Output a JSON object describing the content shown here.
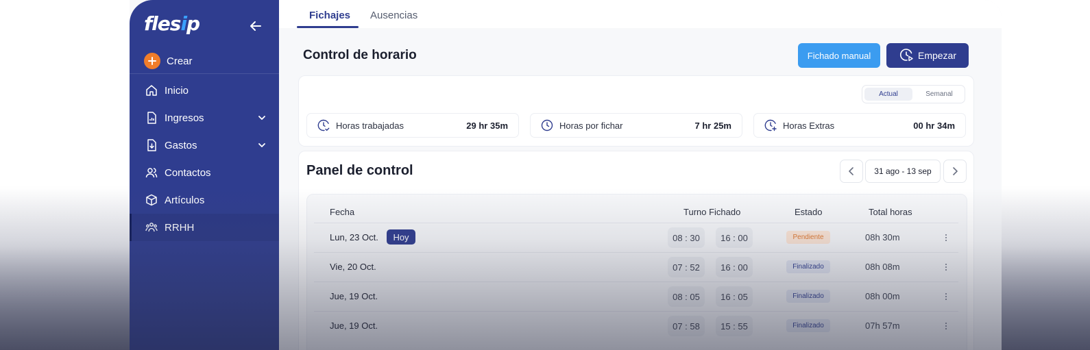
{
  "colors": {
    "brand": "#2f3d8f",
    "accent_blue": "#3b9cf0",
    "create_orange": "#f07d2a",
    "pending": "#e07a33"
  },
  "sidebar": {
    "logo": "flesip",
    "back_icon": "arrow-left-icon",
    "create_label": "Crear",
    "items": [
      {
        "label": "Inicio",
        "icon": "home-icon"
      },
      {
        "label": "Ingresos",
        "icon": "invoice-icon",
        "expandable": true
      },
      {
        "label": "Gastos",
        "icon": "download-doc-icon",
        "expandable": true
      },
      {
        "label": "Contactos",
        "icon": "users-icon"
      },
      {
        "label": "Artículos",
        "icon": "box-icon"
      },
      {
        "label": "RRHH",
        "icon": "team-icon",
        "active": true
      }
    ]
  },
  "tabs": [
    {
      "label": "Fichajes",
      "active": true
    },
    {
      "label": "Ausencias",
      "active": false
    }
  ],
  "header": {
    "title": "Control de horario",
    "manual_button": "Fichado manual",
    "start_button": "Empezar"
  },
  "summary": {
    "toggle": {
      "active": "Actual",
      "inactive": "Semanal"
    },
    "stats": [
      {
        "label": "Horas trabajadas",
        "value": "29 hr 35m"
      },
      {
        "label": "Horas por fichar",
        "value": "7 hr 25m"
      },
      {
        "label": "Horas Extras",
        "value": "00 hr 34m"
      }
    ]
  },
  "panel": {
    "title": "Panel de control",
    "date_range": "31 ago - 13 sep",
    "columns": {
      "date": "Fecha",
      "shift": "Turno Fichado",
      "status": "Estado",
      "total": "Total horas"
    },
    "today_badge": "Hoy",
    "rows": [
      {
        "date": "Lun, 23 Oct.",
        "in": "08 : 30",
        "out": "16 : 00",
        "status": "Pendiente",
        "total": "08h 30m"
      },
      {
        "date": "Vie, 20 Oct.",
        "in": "07 : 52",
        "out": "16 : 00",
        "status": "Finalizado",
        "total": "08h 08m"
      },
      {
        "date": "Jue, 19 Oct.",
        "in": "08 : 05",
        "out": "16 : 05",
        "status": "Finalizado",
        "total": "08h 00m"
      },
      {
        "date": "Jue, 19 Oct.",
        "in": "07 : 58",
        "out": "15 : 55",
        "status": "Finalizado",
        "total": "07h 57m"
      }
    ]
  }
}
